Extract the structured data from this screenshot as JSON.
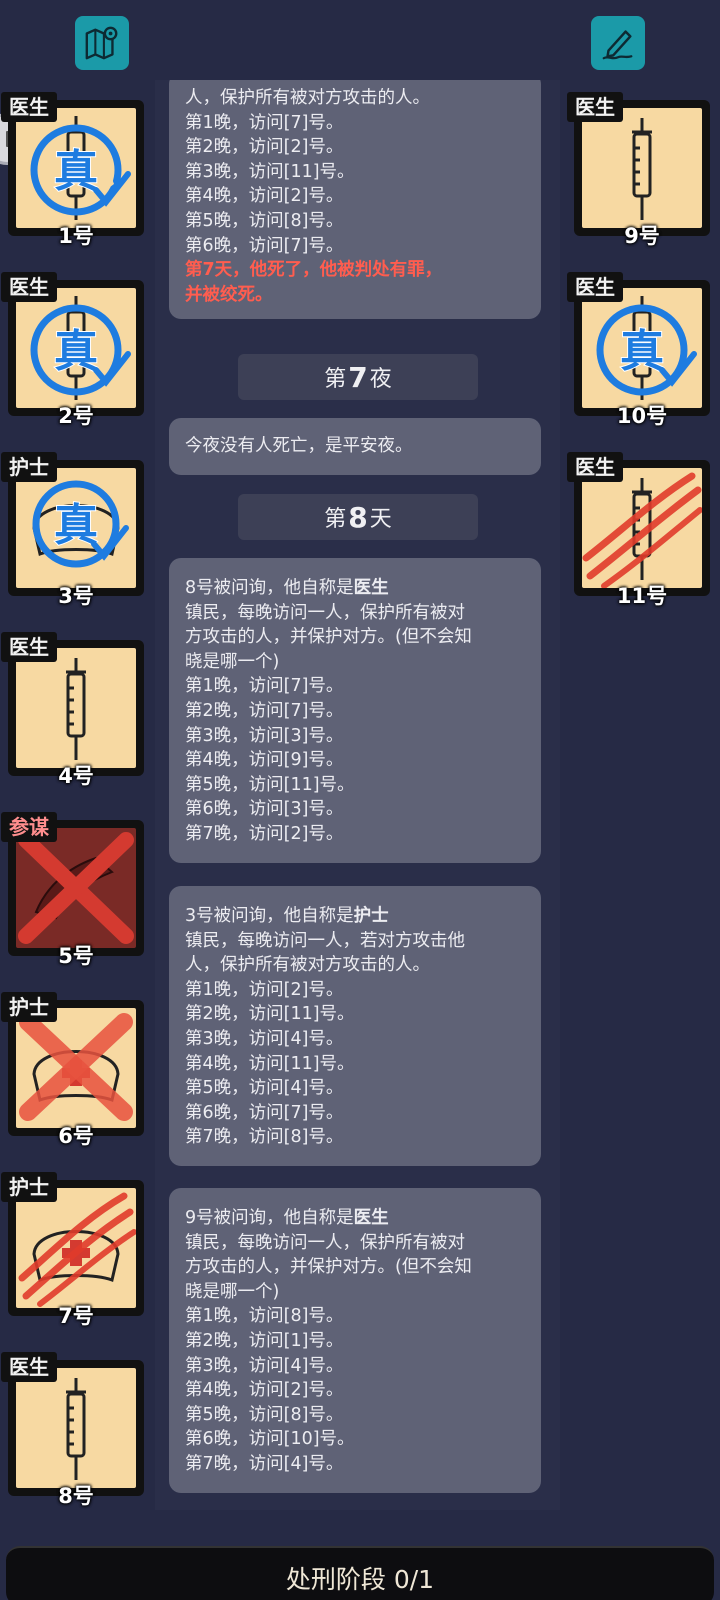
{
  "top": {
    "map_icon": "map-pin-icon",
    "note_icon": "pen-note-icon"
  },
  "left_cards": [
    {
      "role": "医生",
      "num": "1号",
      "state": "verified-syringe"
    },
    {
      "role": "医生",
      "num": "2号",
      "state": "verified-syringe"
    },
    {
      "role": "护士",
      "num": "3号",
      "state": "verified-nurse"
    },
    {
      "role": "医生",
      "num": "4号",
      "state": "syringe"
    },
    {
      "role": "参谋",
      "num": "5号",
      "state": "dead-x"
    },
    {
      "role": "护士",
      "num": "6号",
      "state": "nurse-x"
    },
    {
      "role": "护士",
      "num": "7号",
      "state": "nurse-claw"
    },
    {
      "role": "医生",
      "num": "8号",
      "state": "syringe"
    }
  ],
  "right_cards": [
    {
      "role": "医生",
      "num": "9号",
      "state": "syringe"
    },
    {
      "role": "医生",
      "num": "10号",
      "state": "verified-syringe"
    },
    {
      "role": "医生",
      "num": "11号",
      "state": "syringe-claw"
    }
  ],
  "timeline": {
    "b1": {
      "l1": "人，保护所有被对方攻击的人。",
      "l2": "第1晚，访问[7]号。",
      "l3": "第2晚，访问[2]号。",
      "l4": "第3晚，访问[11]号。",
      "l5": "第4晚，访问[2]号。",
      "l6": "第5晚，访问[8]号。",
      "l7": "第6晚，访问[7]号。",
      "red1": "第7天，他死了，他被判处有罪，",
      "red2": "并被绞死。"
    },
    "night7": {
      "pre": "第",
      "n": "7",
      "post": "夜"
    },
    "b2": {
      "l1": "今夜没有人死亡，是平安夜。"
    },
    "day8": {
      "pre": "第",
      "n": "8",
      "post": "天"
    },
    "b3": {
      "head": "8号被问询，他自称是",
      "role": "医生",
      "d1": "镇民，每晚访问一人，保护所有被对",
      "d2": "方攻击的人，并保护对方。(但不会知",
      "d3": "晓是哪一个)",
      "n1": "第1晚，访问[7]号。",
      "n2": "第2晚，访问[7]号。",
      "n3": "第3晚，访问[3]号。",
      "n4": "第4晚，访问[9]号。",
      "n5": "第5晚，访问[11]号。",
      "n6": "第6晚，访问[3]号。",
      "n7": "第7晚，访问[2]号。"
    },
    "b4": {
      "head": "3号被问询，他自称是",
      "role": "护士",
      "d1": "镇民，每晚访问一人，若对方攻击他",
      "d2": "人，保护所有被对方攻击的人。",
      "n1": "第1晚，访问[2]号。",
      "n2": "第2晚，访问[11]号。",
      "n3": "第3晚，访问[4]号。",
      "n4": "第4晚，访问[11]号。",
      "n5": "第5晚，访问[4]号。",
      "n6": "第6晚，访问[7]号。",
      "n7": "第7晚，访问[8]号。"
    },
    "b5": {
      "head": "9号被问询，他自称是",
      "role": "医生",
      "d1": "镇民，每晚访问一人，保护所有被对",
      "d2": "方攻击的人，并保护对方。(但不会知",
      "d3": "晓是哪一个)",
      "n1": "第1晚，访问[8]号。",
      "n2": "第2晚，访问[1]号。",
      "n3": "第3晚，访问[4]号。",
      "n4": "第4晚，访问[2]号。",
      "n5": "第5晚，访问[8]号。",
      "n6": "第6晚，访问[10]号。",
      "n7": "第7晚，访问[4]号。"
    }
  },
  "bottom": {
    "label": "处刑阶段 0/1"
  },
  "colors": {
    "accent": "#1b9aa8",
    "card": "#f7d9a2",
    "verify": "#1e7ce0",
    "claw": "#e03b2b"
  }
}
